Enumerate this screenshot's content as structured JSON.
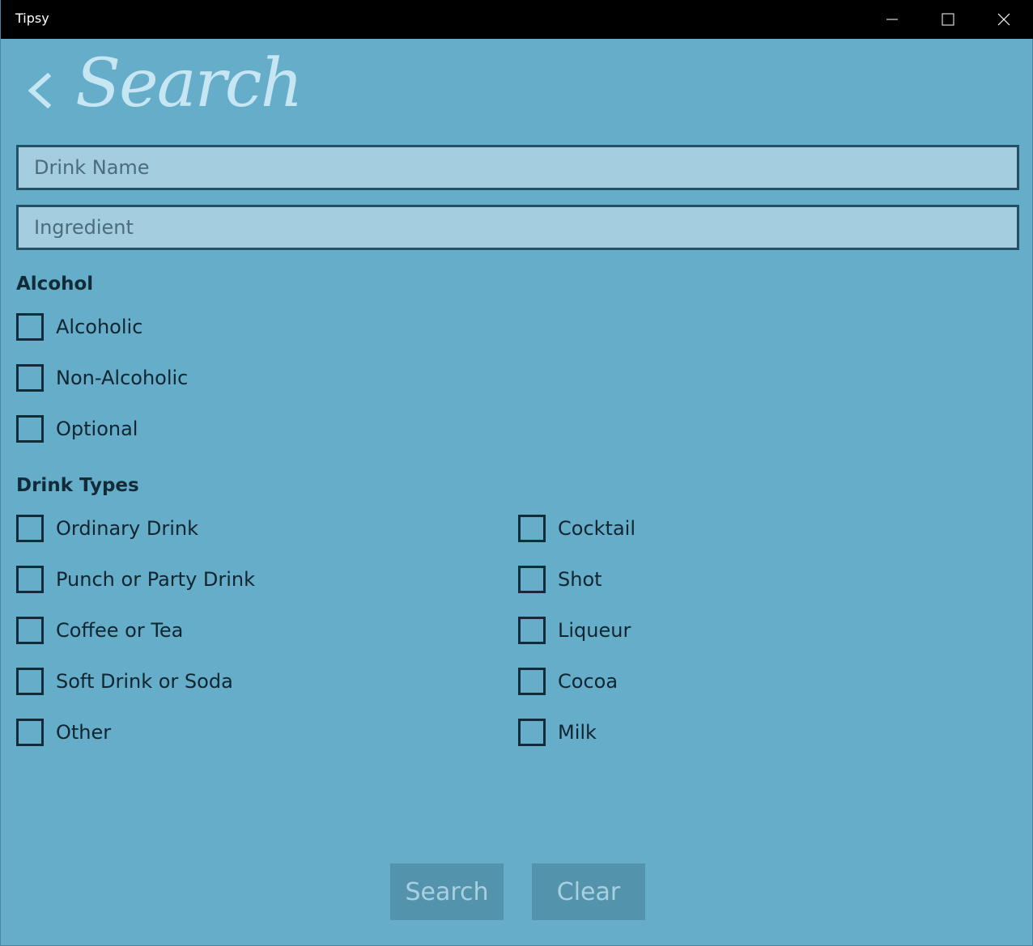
{
  "window": {
    "title": "Tipsy"
  },
  "header": {
    "title": "Search",
    "back_icon": "chevron-left-icon"
  },
  "fields": {
    "drink_name_placeholder": "Drink Name",
    "drink_name_value": "",
    "ingredient_placeholder": "Ingredient",
    "ingredient_value": ""
  },
  "alcohol": {
    "label": "Alcohol",
    "options": [
      {
        "label": "Alcoholic",
        "checked": false
      },
      {
        "label": "Non-Alcoholic",
        "checked": false
      },
      {
        "label": "Optional",
        "checked": false
      }
    ]
  },
  "drink_types": {
    "label": "Drink Types",
    "left": [
      {
        "label": "Ordinary Drink",
        "checked": false
      },
      {
        "label": "Punch or Party Drink",
        "checked": false
      },
      {
        "label": "Coffee or Tea",
        "checked": false
      },
      {
        "label": "Soft Drink or Soda",
        "checked": false
      },
      {
        "label": "Other",
        "checked": false
      }
    ],
    "right": [
      {
        "label": "Cocktail",
        "checked": false
      },
      {
        "label": "Shot",
        "checked": false
      },
      {
        "label": "Liqueur",
        "checked": false
      },
      {
        "label": "Cocoa",
        "checked": false
      },
      {
        "label": "Milk",
        "checked": false
      }
    ]
  },
  "actions": {
    "search_label": "Search",
    "clear_label": "Clear"
  },
  "colors": {
    "background": "#66adca",
    "title_bar": "#000000",
    "field_background": "#a4cddf",
    "field_border": "#245063",
    "button_background": "#5493ac",
    "button_text": "#a9d0e1",
    "title_text": "#c7e6f3"
  }
}
